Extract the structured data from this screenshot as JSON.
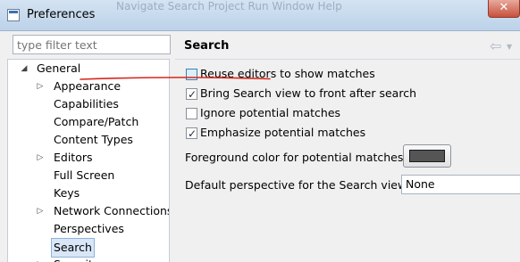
{
  "window": {
    "title": "Preferences",
    "background_menu_text": "Navigate  Search  Project  Run  Window  Help",
    "close_glyph": "✕"
  },
  "filter": {
    "placeholder": "type filter text"
  },
  "tree": {
    "items": [
      {
        "label": "General",
        "toggle": "◢",
        "expanded": true
      },
      {
        "label": "Appearance",
        "toggle": "▷"
      },
      {
        "label": "Capabilities",
        "toggle": ""
      },
      {
        "label": "Compare/Patch",
        "toggle": ""
      },
      {
        "label": "Content Types",
        "toggle": ""
      },
      {
        "label": "Editors",
        "toggle": "▷"
      },
      {
        "label": "Full Screen",
        "toggle": ""
      },
      {
        "label": "Keys",
        "toggle": ""
      },
      {
        "label": "Network Connections",
        "toggle": "▷"
      },
      {
        "label": "Perspectives",
        "toggle": ""
      },
      {
        "label": "Search",
        "toggle": "",
        "selected": true
      },
      {
        "label": "Security",
        "toggle": "▷"
      }
    ]
  },
  "page": {
    "title": "Search",
    "back_icon": "⇦",
    "options": [
      {
        "label": "Reuse editors to show matches",
        "checked": false,
        "hover": true
      },
      {
        "label": "Bring Search view to front after search",
        "checked": true
      },
      {
        "label": "Ignore potential matches",
        "checked": false
      },
      {
        "label": "Emphasize potential matches",
        "checked": true
      }
    ],
    "foreground_color_label": "Foreground color for potential matches:",
    "foreground_color": "#555555",
    "perspective_label": "Default perspective for the Search view:",
    "perspective_value": "None",
    "annotation_color": "#d9261c"
  }
}
